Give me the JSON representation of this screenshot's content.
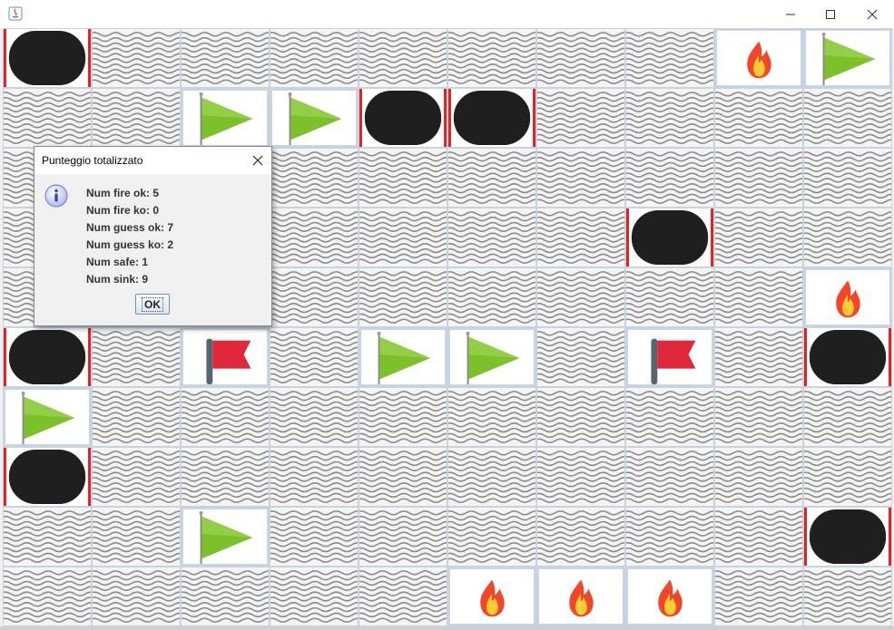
{
  "window": {
    "controls": [
      "minimize-icon",
      "maximize-icon",
      "close-icon"
    ]
  },
  "board": {
    "rows": 10,
    "cols": 10,
    "legend": {
      "W": "water",
      "B": "ship-hit",
      "F": "fire",
      "G": "green-flag",
      "R": "red-flag"
    },
    "cells": [
      "BWWWWWWWFG",
      "WWGGBBWWWW",
      "WWWWWWWWWW",
      "WWWWWWWBWW",
      "WWWWWWWWWF",
      "BWRWGGWRWB",
      "GWWWWWWWWW",
      "BWWWWWWWWW",
      "WWGWWWWWWB",
      "WWWWWFFFWW"
    ]
  },
  "dialog": {
    "title": "Punteggio totalizzato",
    "lines": [
      "Num fire ok: 5",
      "Num fire ko: 0",
      "Num guess ok: 7",
      "Num guess ko: 2",
      "Num safe: 1",
      "Num sink: 9"
    ],
    "ok_label": "OK"
  },
  "colors": {
    "ship": "#1f1f1f",
    "ship_edge": "#e02020",
    "green_flag": "#7cc02a",
    "red_flag": "#e0283c",
    "fire_outer": "#f2452a",
    "fire_inner": "#ffcc33"
  }
}
